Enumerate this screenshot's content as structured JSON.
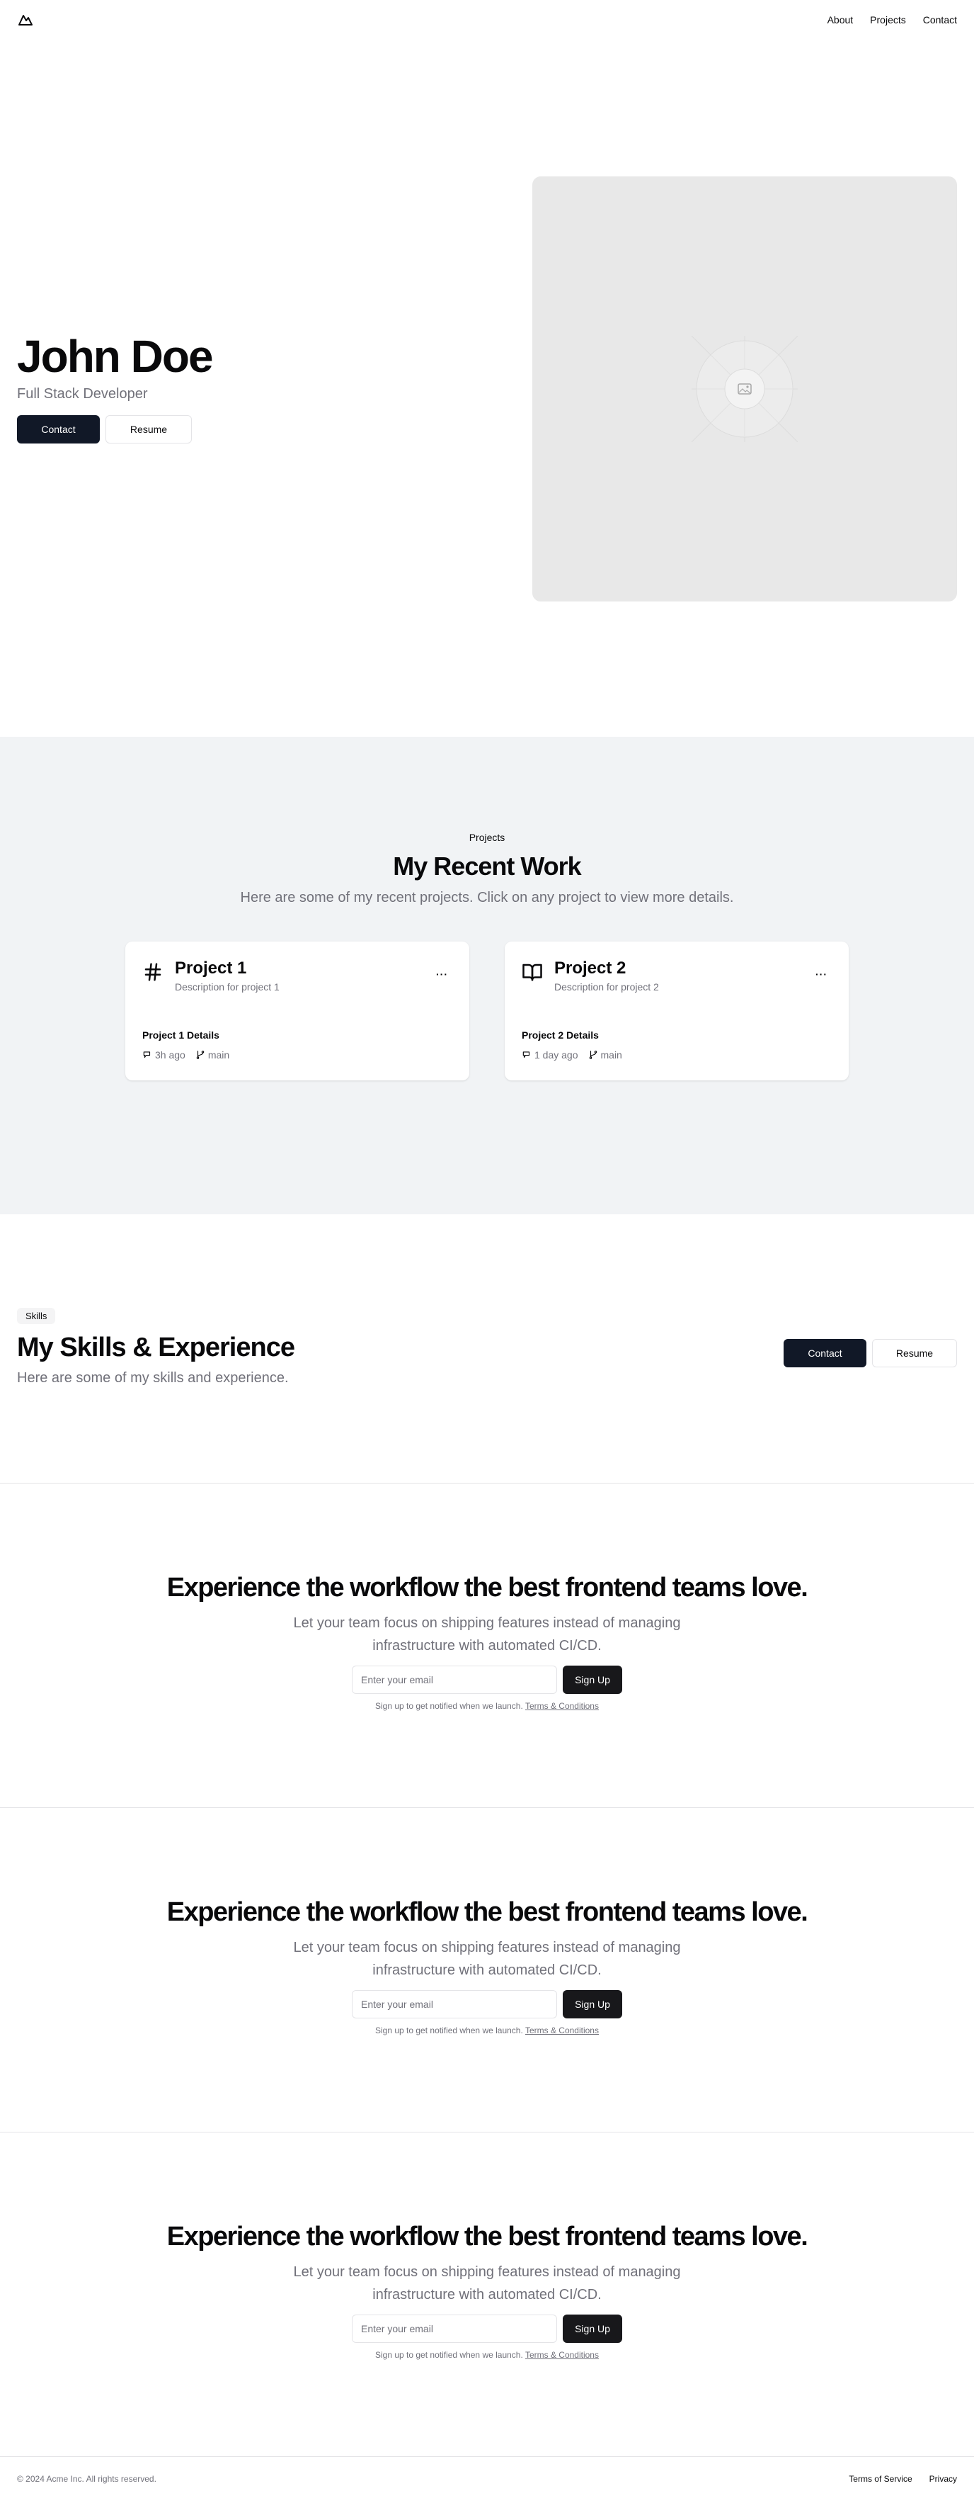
{
  "header": {
    "logo_icon": "mountain-icon",
    "nav": [
      "About",
      "Projects",
      "Contact"
    ]
  },
  "hero": {
    "name": "John Doe",
    "role": "Full Stack Developer",
    "primary_button": "Contact",
    "secondary_button": "Resume",
    "image_icon": "image-placeholder-icon"
  },
  "projects": {
    "eyebrow": "Projects",
    "title": "My Recent Work",
    "subtitle": "Here are some of my recent projects. Click on any project to view more details.",
    "cards": [
      {
        "icon": "hash-icon",
        "title": "Project 1",
        "description": "Description for project 1",
        "details": "Project 1 Details",
        "updated": "3h ago",
        "branch": "main"
      },
      {
        "icon": "book-open-icon",
        "title": "Project 2",
        "description": "Description for project 2",
        "details": "Project 2 Details",
        "updated": "1 day ago",
        "branch": "main"
      }
    ]
  },
  "skills": {
    "badge": "Skills",
    "title": "My Skills & Experience",
    "subtitle": "Here are some of my skills and experience.",
    "primary_button": "Contact",
    "secondary_button": "Resume"
  },
  "cta_sections": [
    {
      "title": "Experience the workflow the best frontend teams love.",
      "subtitle": "Let your team focus on shipping features instead of managing infrastructure with automated CI/CD.",
      "placeholder": "Enter your email",
      "button": "Sign Up",
      "note": "Sign up to get notified when we launch.",
      "note_link": "Terms & Conditions"
    },
    {
      "title": "Experience the workflow the best frontend teams love.",
      "subtitle": "Let your team focus on shipping features instead of managing infrastructure with automated CI/CD.",
      "placeholder": "Enter your email",
      "button": "Sign Up",
      "note": "Sign up to get notified when we launch.",
      "note_link": "Terms & Conditions"
    },
    {
      "title": "Experience the workflow the best frontend teams love.",
      "subtitle": "Let your team focus on shipping features instead of managing infrastructure with automated CI/CD.",
      "placeholder": "Enter your email",
      "button": "Sign Up",
      "note": "Sign up to get notified when we launch.",
      "note_link": "Terms & Conditions"
    }
  ],
  "footer": {
    "copyright": "© 2024 Acme Inc. All rights reserved.",
    "links": [
      "Terms of Service",
      "Privacy"
    ]
  }
}
